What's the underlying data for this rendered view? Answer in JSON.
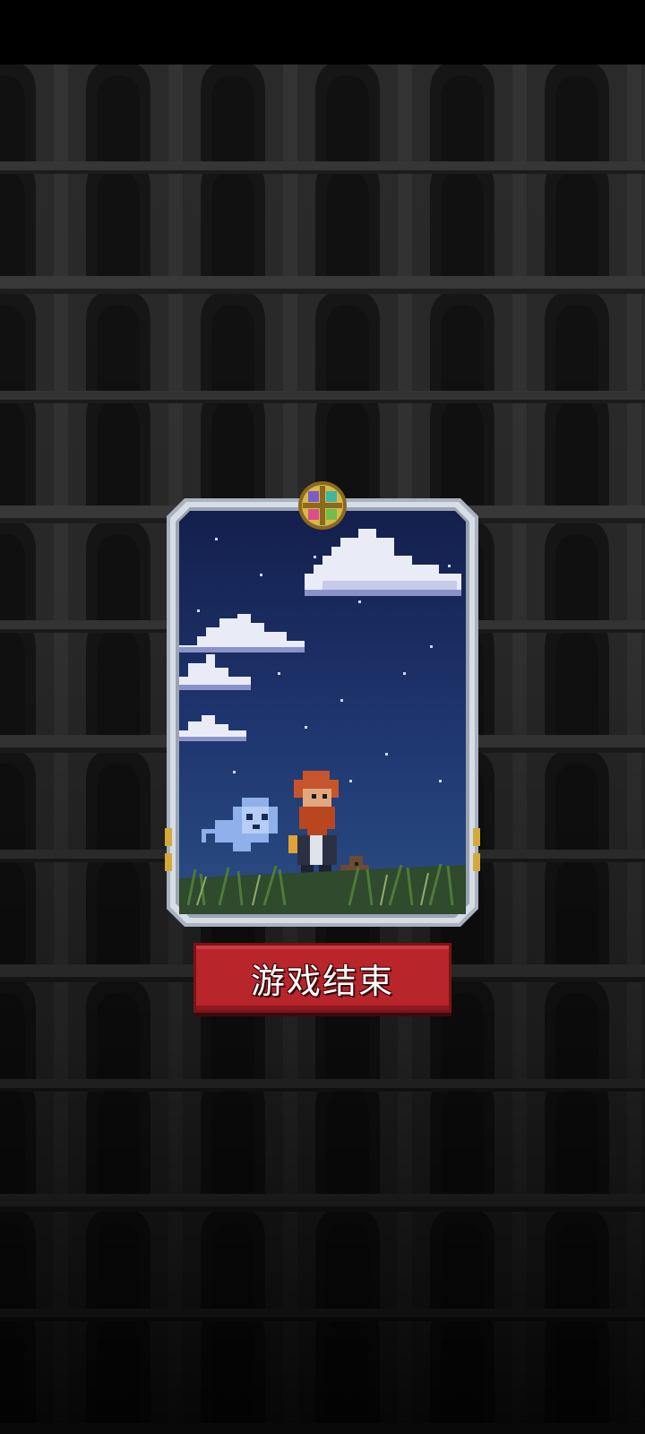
{
  "game": {
    "game_over_label": "游戏结束"
  },
  "background": {
    "name": "tower-arches",
    "colors": {
      "wall": "#2b2b2b",
      "wall_light": "#343434",
      "arch": "#161616",
      "ledge": "#3a3a3a"
    }
  },
  "card": {
    "icon": "compass-medallion-icon",
    "frame_color": "#c4ccd6",
    "sky_colors": [
      "#141f4d",
      "#1f3670",
      "#2a4d83"
    ],
    "characters": [
      "ghost",
      "bearded-hero",
      "companion-dog"
    ]
  }
}
